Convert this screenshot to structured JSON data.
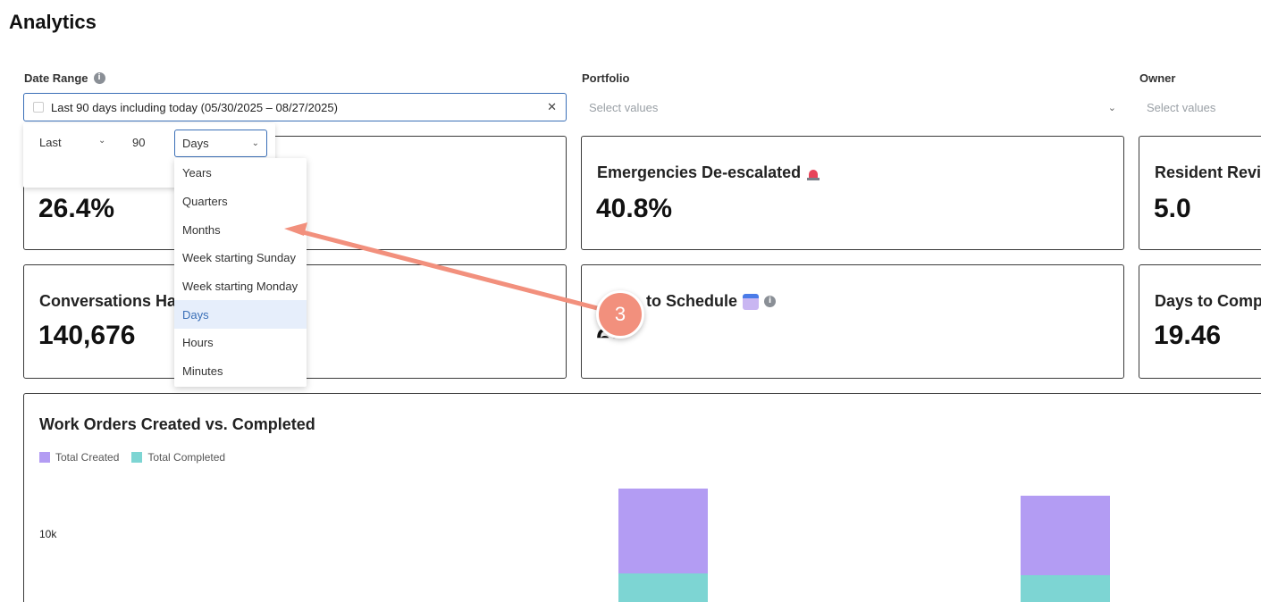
{
  "page": {
    "title": "Analytics"
  },
  "filters": {
    "date_range": {
      "label": "Date Range",
      "value": "Last 90 days including today (05/30/2025 – 08/27/2025)"
    },
    "portfolio": {
      "label": "Portfolio",
      "placeholder": "Select values"
    },
    "owner": {
      "label": "Owner",
      "placeholder": "Select values"
    }
  },
  "date_popover": {
    "mode": "Last",
    "number": "90",
    "unit": "Days",
    "options": [
      "Years",
      "Quarters",
      "Months",
      "Week starting Sunday",
      "Week starting Monday",
      "Days",
      "Hours",
      "Minutes"
    ],
    "selected_index": 5
  },
  "metrics": [
    {
      "title": "",
      "value": "26.4%"
    },
    {
      "title": "Emergencies De-escalated",
      "value": "40.8%",
      "icon": "siren-icon"
    },
    {
      "title": "Resident Revie",
      "value": "5.0"
    },
    {
      "title": "Conversations Ha",
      "value": "140,676"
    },
    {
      "title": "to Schedule",
      "visible_value": "64",
      "icon": "calendar-icon"
    },
    {
      "title": "Days to Comp",
      "value": "19.46"
    }
  ],
  "chart": {
    "title": "Work Orders Created vs. Completed",
    "legend": [
      "Total Created",
      "Total Completed"
    ],
    "colors": {
      "created": "#b39cf3",
      "completed": "#7dd5d3"
    },
    "ytick": "10k"
  },
  "chart_data": {
    "type": "bar",
    "title": "Work Orders Created vs. Completed",
    "series": [
      {
        "name": "Total Created"
      },
      {
        "name": "Total Completed"
      }
    ],
    "y_ticks": [
      "10k"
    ]
  },
  "annotation": {
    "step_number": "3",
    "color": "#f2907d"
  }
}
